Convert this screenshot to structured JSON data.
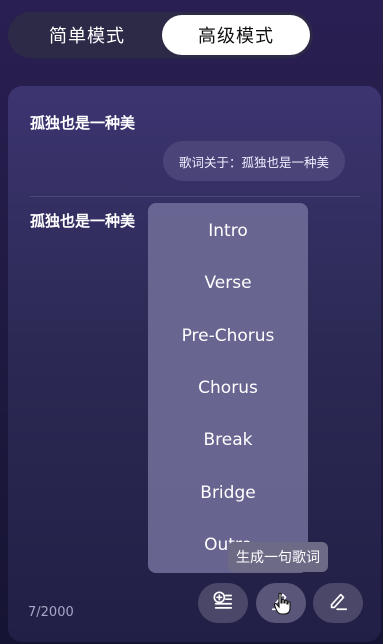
{
  "mode_toggle": {
    "simple_label": "简单模式",
    "advanced_label": "高级模式",
    "active": "advanced"
  },
  "card": {
    "title": "孤独也是一种美",
    "topic_chip": "歌词关于：孤独也是一种美",
    "lyric_line": "孤独也是一种美",
    "counter": "7/2000"
  },
  "dropdown": {
    "items": [
      "Intro",
      "Verse",
      "Pre-Chorus",
      "Chorus",
      "Break",
      "Bridge",
      "Outro"
    ]
  },
  "tooltip": {
    "text": "生成一句歌词"
  },
  "actions": {
    "add_icon": "add-lines-icon",
    "generate_icon": "ai-write-icon",
    "edit_icon": "pen-edit-icon"
  },
  "colors": {
    "background": "#1d1940",
    "card": "#2c2a55",
    "active_toggle": "#ffffff",
    "dropdown": "#6e6a96"
  }
}
